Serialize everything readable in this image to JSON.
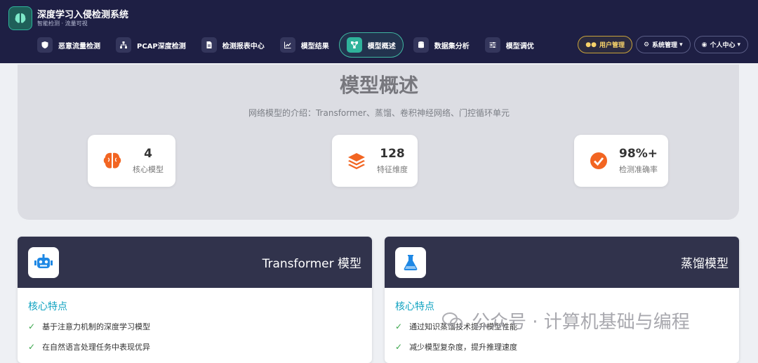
{
  "app": {
    "title": "深度学习入侵检测系统",
    "subtitle": "智能检测 · 流量可视"
  },
  "nav": {
    "items": [
      {
        "label": "恶意流量检测",
        "icon": "shield-icon"
      },
      {
        "label": "PCAP深度检测",
        "icon": "network-icon"
      },
      {
        "label": "检测报表中心",
        "icon": "file-icon"
      },
      {
        "label": "模型结果",
        "icon": "chart-line-icon"
      },
      {
        "label": "模型概述",
        "icon": "diagram-icon",
        "active": true
      },
      {
        "label": "数据集分析",
        "icon": "database-icon"
      },
      {
        "label": "模型调优",
        "icon": "sliders-icon"
      }
    ],
    "user_mgmt": "用户管理",
    "sys_mgmt": "系统管理",
    "personal": "个人中心"
  },
  "hero": {
    "title": "模型概述",
    "subtitle": "网络模型的介绍：Transformer、蒸馏、卷积神经网络、门控循环单元",
    "stats": [
      {
        "value": "4",
        "label": "核心模型",
        "icon": "brain-icon"
      },
      {
        "value": "128",
        "label": "特征维度",
        "icon": "layers-icon"
      },
      {
        "value": "98%+",
        "label": "检测准确率",
        "icon": "check-circle-icon"
      }
    ]
  },
  "cards": [
    {
      "title": "Transformer 模型",
      "icon": "robot-icon",
      "section": "核心特点",
      "features": [
        "基于注意力机制的深度学习模型",
        "在自然语言处理任务中表现优异"
      ]
    },
    {
      "title": "蒸馏模型",
      "icon": "flask-icon",
      "section": "核心特点",
      "features": [
        "通过知识蒸馏技术提升模型性能",
        "减少模型复杂度，提升推理速度"
      ]
    }
  ],
  "watermark": "公众号 · 计算机基础与编程",
  "colors": {
    "navbar": "#1e1f44",
    "accent": "#2fb39b",
    "orange": "#f26522",
    "card_head": "#31334c",
    "section": "#11a3c1"
  }
}
